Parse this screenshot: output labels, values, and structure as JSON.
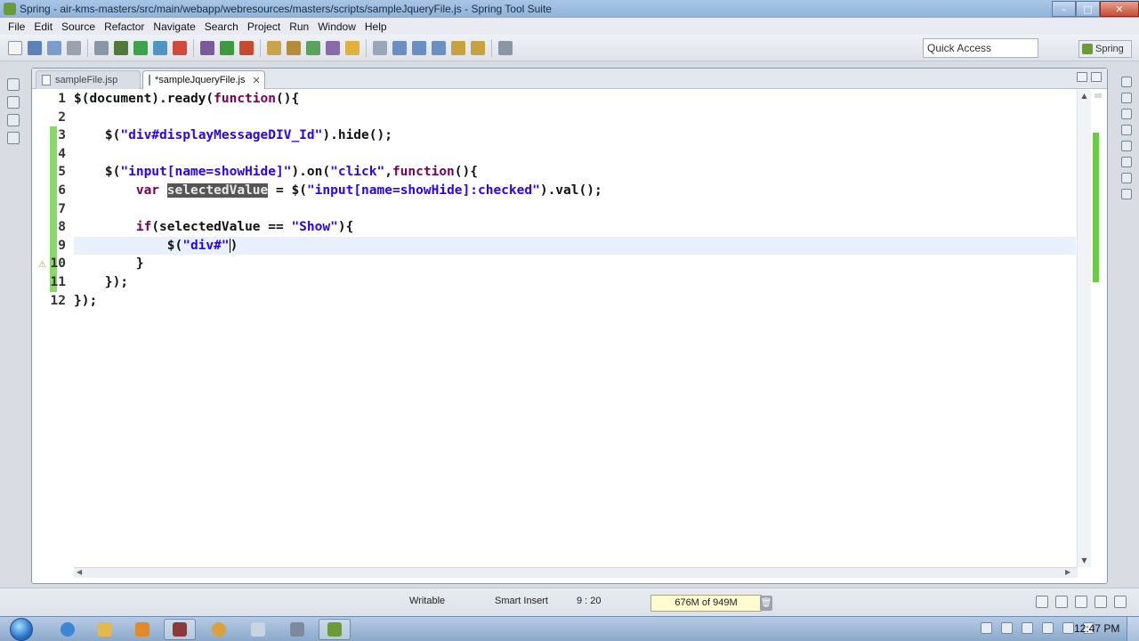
{
  "window": {
    "title": "Spring - air-kms-masters/src/main/webapp/webresources/masters/scripts/sampleJqueryFile.js - Spring Tool Suite",
    "minimize": "–",
    "maximize": "□",
    "close": "✕"
  },
  "menu": [
    {
      "label": "File"
    },
    {
      "label": "Edit"
    },
    {
      "label": "Source"
    },
    {
      "label": "Refactor"
    },
    {
      "label": "Navigate"
    },
    {
      "label": "Search"
    },
    {
      "label": "Project"
    },
    {
      "label": "Run"
    },
    {
      "label": "Window"
    },
    {
      "label": "Help"
    }
  ],
  "toolbar": {
    "quick_access_placeholder": "Quick Access",
    "perspective_label": "Spring"
  },
  "tabs": [
    {
      "label": "sampleFile.jsp",
      "close": ""
    },
    {
      "label": "*sampleJqueryFile.js",
      "close": "✕"
    }
  ],
  "editor": {
    "line_numbers": [
      "1",
      "2",
      "3",
      "4",
      "5",
      "6",
      "7",
      "8",
      "9",
      "10",
      "11",
      "12"
    ],
    "changed_lines": [
      3,
      4,
      5,
      6,
      7,
      8,
      9,
      10,
      11
    ],
    "warning_line": 9,
    "current_line": 9,
    "lines": [
      "$(document).ready(function(){",
      "",
      "    $(\"div#displayMessageDIV_Id\").hide();",
      "",
      "    $(\"input[name=showHide]\").on(\"click\",function(){",
      "        var selectedValue = $(\"input[name=showHide]:checked\").val();",
      "",
      "        if(selectedValue == \"Show\"){",
      "            $(\"div#\")",
      "        }",
      "    });",
      "});"
    ],
    "selected_word": "selectedValue"
  },
  "status": {
    "writable": "Writable",
    "insert_mode": "Smart Insert",
    "cursor_position": "9 : 20",
    "heap": "676M of 949M"
  },
  "taskbar": {
    "clock": "12:47 PM"
  },
  "colors": {
    "keyword": "#7a0055",
    "string": "#2a00ff",
    "changed_marker": "#88d86a",
    "current_line": "#e8f0fb"
  }
}
